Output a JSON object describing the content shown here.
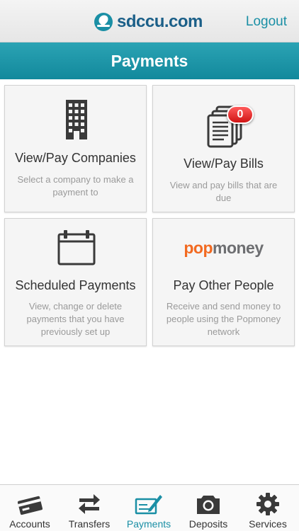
{
  "header": {
    "brand": "sdccu.com",
    "logout_label": "Logout"
  },
  "title": "Payments",
  "tiles": [
    {
      "title": "View/Pay Companies",
      "description": "Select a company to make a payment to",
      "icon": "building-icon"
    },
    {
      "title": "View/Pay Bills",
      "description": "View and pay bills that are due",
      "icon": "bills-icon",
      "badge": "0"
    },
    {
      "title": "Scheduled Payments",
      "description": "View, change or delete payments that you have previously set up",
      "icon": "calendar-icon"
    },
    {
      "title": "Pay Other People",
      "description": "Receive and send money to people using the Popmoney network",
      "icon": "popmoney-logo",
      "logo_pop": "pop",
      "logo_money": "money"
    }
  ],
  "tabbar": {
    "items": [
      {
        "label": "Accounts",
        "icon": "credit-card-icon"
      },
      {
        "label": "Transfers",
        "icon": "transfer-arrows-icon"
      },
      {
        "label": "Payments",
        "icon": "payment-check-icon",
        "active": true
      },
      {
        "label": "Deposits",
        "icon": "camera-icon"
      },
      {
        "label": "Services",
        "icon": "gear-icon"
      }
    ]
  },
  "colors": {
    "accent": "#1a8fa5",
    "brand": "#1b5f88",
    "badge": "#e01e1e",
    "popmoney_orange": "#f26a21",
    "popmoney_gray": "#6d6e71"
  }
}
